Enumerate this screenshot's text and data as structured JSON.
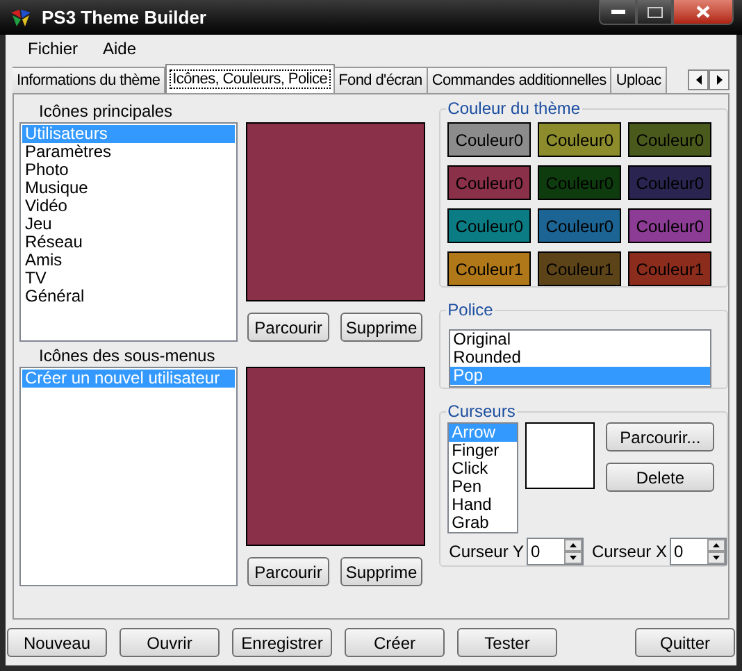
{
  "window": {
    "title": "PS3 Theme Builder"
  },
  "menu": [
    "Fichier",
    "Aide"
  ],
  "tabs": [
    {
      "label": "Informations du thème",
      "selected": false
    },
    {
      "label": "Icônes, Couleurs, Police",
      "selected": true
    },
    {
      "label": "Fond d'écran",
      "selected": false
    },
    {
      "label": "Commandes additionnelles",
      "selected": false
    },
    {
      "label": "Uploac",
      "selected": false
    }
  ],
  "main_icons": {
    "label": "Icônes principales",
    "items": [
      {
        "label": "Utilisateurs",
        "selected": true
      },
      {
        "label": "Paramètres",
        "selected": false
      },
      {
        "label": "Photo",
        "selected": false
      },
      {
        "label": "Musique",
        "selected": false
      },
      {
        "label": "Vidéo",
        "selected": false
      },
      {
        "label": "Jeu",
        "selected": false
      },
      {
        "label": "Réseau",
        "selected": false
      },
      {
        "label": "Amis",
        "selected": false
      },
      {
        "label": "TV",
        "selected": false
      },
      {
        "label": "Général",
        "selected": false
      }
    ],
    "buttons": [
      "Parcourir",
      "Supprime"
    ]
  },
  "submenu_icons": {
    "label": "Icônes des sous-menus",
    "items": [
      {
        "label": "Créer un nouvel utilisateur",
        "selected": true
      }
    ],
    "buttons": [
      "Parcourir",
      "Supprime"
    ]
  },
  "theme_colors": {
    "label": "Couleur du thème",
    "swatches": [
      {
        "label": "Couleur0",
        "color": "#8c8c8c"
      },
      {
        "label": "Couleur0",
        "color": "#8c8c2c"
      },
      {
        "label": "Couleur0",
        "color": "#4a5a1c"
      },
      {
        "label": "Couleur0",
        "color": "#8b3049"
      },
      {
        "label": "Couleur0",
        "color": "#0e3c0e"
      },
      {
        "label": "Couleur0",
        "color": "#2a2450"
      },
      {
        "label": "Couleur0",
        "color": "#0c7c84"
      },
      {
        "label": "Couleur0",
        "color": "#1c6494"
      },
      {
        "label": "Couleur0",
        "color": "#8c3c94"
      },
      {
        "label": "Couleur1",
        "color": "#b07818"
      },
      {
        "label": "Couleur1",
        "color": "#5c4418"
      },
      {
        "label": "Couleur1",
        "color": "#8c2c1c"
      }
    ]
  },
  "font": {
    "label": "Police",
    "items": [
      {
        "label": "Original",
        "selected": false
      },
      {
        "label": "Rounded",
        "selected": false
      },
      {
        "label": "Pop",
        "selected": true
      }
    ]
  },
  "cursors": {
    "label": "Curseurs",
    "items": [
      {
        "label": "Arrow",
        "selected": true
      },
      {
        "label": "Finger",
        "selected": false
      },
      {
        "label": "Click",
        "selected": false
      },
      {
        "label": "Pen",
        "selected": false
      },
      {
        "label": "Hand",
        "selected": false
      },
      {
        "label": "Grab",
        "selected": false
      }
    ],
    "buttons": [
      "Parcourir...",
      "Delete"
    ],
    "cursor_y": {
      "label": "Curseur Y",
      "value": "0"
    },
    "cursor_x": {
      "label": "Curseur X",
      "value": "0"
    }
  },
  "footer_buttons": [
    "Nouveau",
    "Ouvrir",
    "Enregistrer",
    "Créer",
    "Tester",
    "Quitter"
  ]
}
